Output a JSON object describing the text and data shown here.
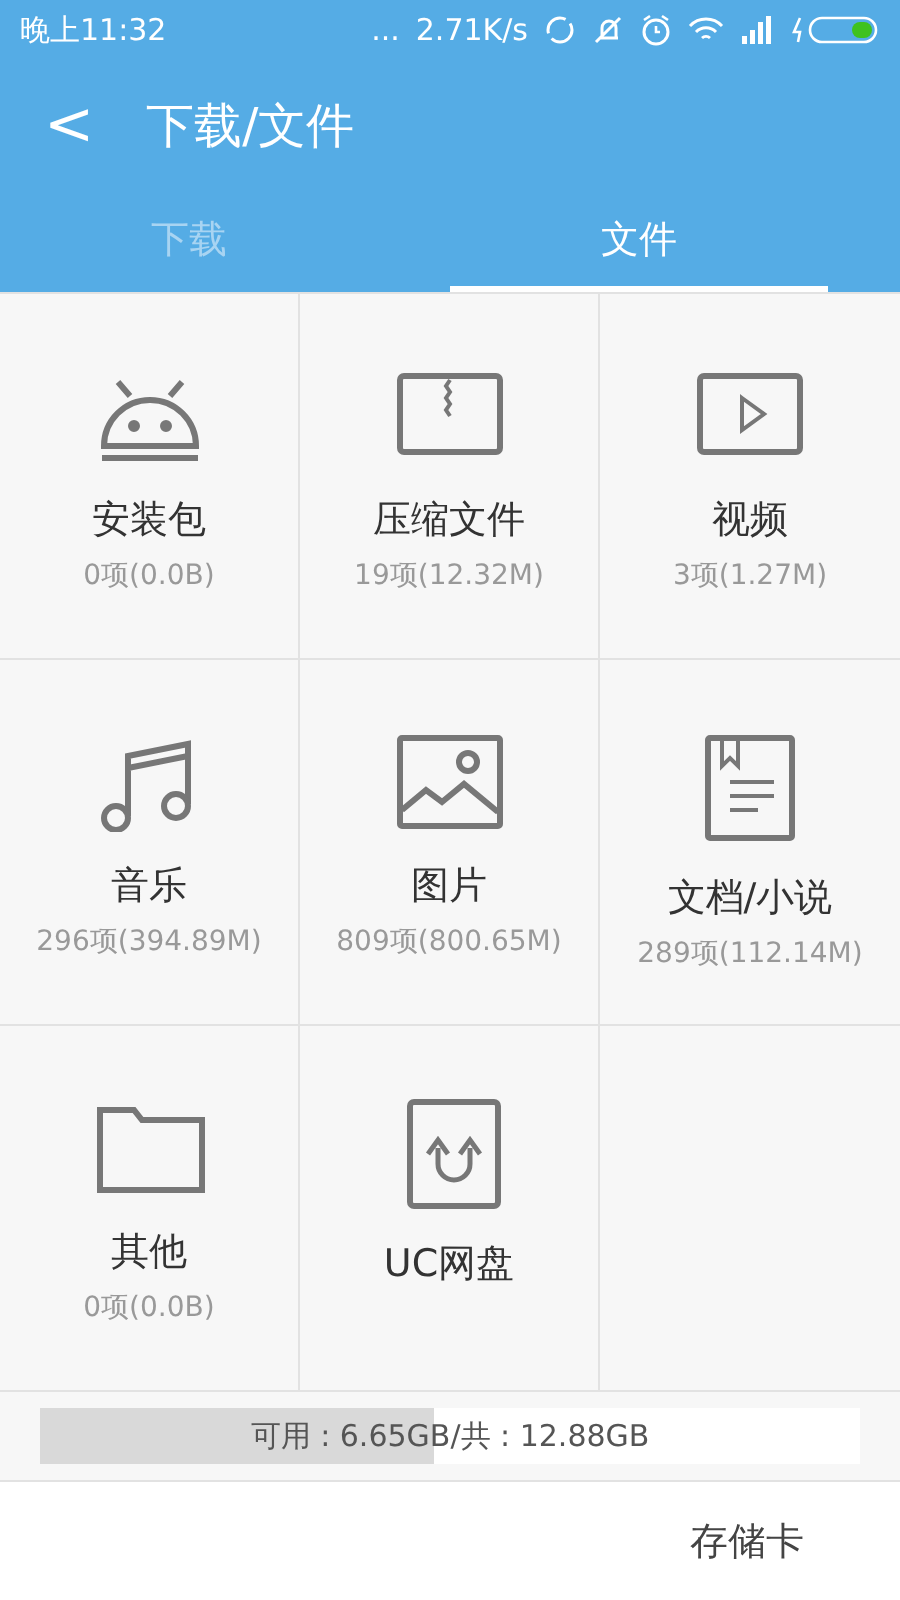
{
  "status_bar": {
    "time": "晚上11:32",
    "dots": "...",
    "speed": "2.71K/s"
  },
  "header": {
    "back": "<",
    "title": "下载/文件"
  },
  "tabs": [
    {
      "label": "下载",
      "selected": false
    },
    {
      "label": "文件",
      "selected": true
    }
  ],
  "categories": [
    {
      "kind": "android",
      "name": "安装包",
      "count": "0项(0.0B)"
    },
    {
      "kind": "zip",
      "name": "压缩文件",
      "count": "19项(12.32M)"
    },
    {
      "kind": "video",
      "name": "视频",
      "count": "3项(1.27M)"
    },
    {
      "kind": "music",
      "name": "音乐",
      "count": "296项(394.89M)"
    },
    {
      "kind": "image",
      "name": "图片",
      "count": "809项(800.65M)"
    },
    {
      "kind": "document",
      "name": "文档/小说",
      "count": "289项(112.14M)"
    },
    {
      "kind": "folder",
      "name": "其他",
      "count": "0项(0.0B)"
    },
    {
      "kind": "cloud",
      "name": "UC网盘"
    }
  ],
  "storage": {
    "text": "可用 : 6.65GB/共 : 12.88GB",
    "level": 0.48
  },
  "footer": {
    "label": "存储卡"
  }
}
